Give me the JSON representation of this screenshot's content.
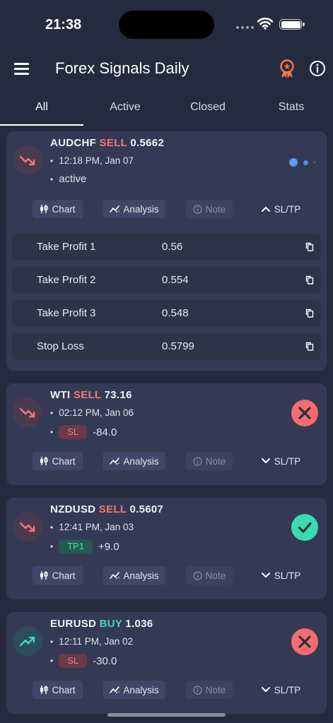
{
  "status_bar": {
    "time": "21:38"
  },
  "app_bar": {
    "title": "Forex Signals Daily"
  },
  "tabs": [
    "All",
    "Active",
    "Closed",
    "Stats"
  ],
  "action_labels": {
    "chart": "Chart",
    "analysis": "Analysis",
    "note": "Note",
    "sltp": "SL/TP"
  },
  "colors": {
    "sell": "#f2777a",
    "buy": "#46d8b4",
    "loss": "#f46c6d",
    "win": "#37dcb0",
    "active_dot": "#5a9cf7"
  },
  "signals": [
    {
      "pair": "AUDCHF",
      "side": "SELL",
      "price": "0.5662",
      "time": "12:18 PM, Jan 07",
      "status": "active",
      "expanded": true,
      "levels": [
        {
          "label": "Take Profit 1",
          "value": "0.56"
        },
        {
          "label": "Take Profit 2",
          "value": "0.554"
        },
        {
          "label": "Take Profit 3",
          "value": "0.548"
        },
        {
          "label": "Stop Loss",
          "value": "0.5799"
        }
      ]
    },
    {
      "pair": "WTI",
      "side": "SELL",
      "price": "73.16",
      "time": "02:12 PM, Jan 06",
      "result_tag": "SL",
      "pips": "-84.0",
      "outcome": "loss"
    },
    {
      "pair": "NZDUSD",
      "side": "SELL",
      "price": "0.5607",
      "time": "12:41 PM, Jan 03",
      "result_tag": "TP1",
      "pips": "+9.0",
      "outcome": "win"
    },
    {
      "pair": "EURUSD",
      "side": "BUY",
      "price": "1.036",
      "time": "12:11 PM, Jan 02",
      "result_tag": "SL",
      "pips": "-30.0",
      "outcome": "loss"
    }
  ]
}
